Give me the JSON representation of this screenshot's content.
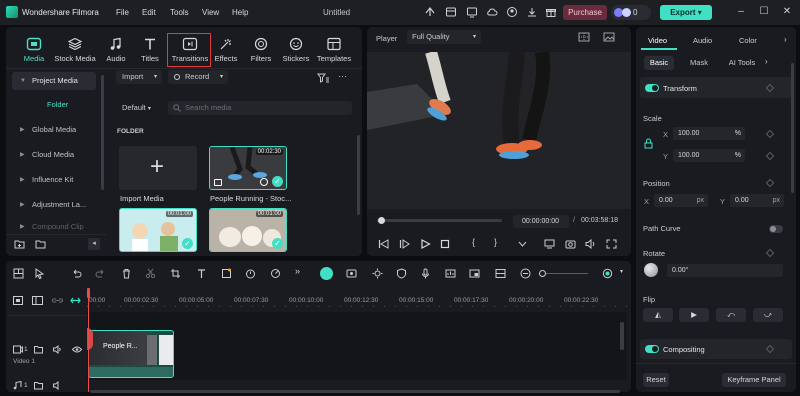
{
  "titlebar": {
    "app_name": "Wondershare Filmora",
    "menu": [
      "File",
      "Edit",
      "Tools",
      "View",
      "Help"
    ],
    "doc_title": "Untitled",
    "purchase_label": "Purchase",
    "credits": "0",
    "export_label": "Export"
  },
  "media_tabs": [
    {
      "label": "Media",
      "icon": "media-icon",
      "active": true
    },
    {
      "label": "Stock Media",
      "icon": "stock-media-icon",
      "active": false
    },
    {
      "label": "Audio",
      "icon": "audio-icon",
      "active": false
    },
    {
      "label": "Titles",
      "icon": "titles-icon",
      "active": false
    },
    {
      "label": "Transitions",
      "icon": "transitions-icon",
      "active": false
    },
    {
      "label": "Effects",
      "icon": "effects-icon",
      "active": false
    },
    {
      "label": "Filters",
      "icon": "filters-icon",
      "active": false
    },
    {
      "label": "Stickers",
      "icon": "stickers-icon",
      "active": false
    },
    {
      "label": "Templates",
      "icon": "templates-icon",
      "active": false
    }
  ],
  "media_sidebar": {
    "items": [
      {
        "label": "Project Media",
        "expanded": true
      },
      {
        "label": "Folder",
        "sub": true
      },
      {
        "label": "Global Media"
      },
      {
        "label": "Cloud Media"
      },
      {
        "label": "Influence Kit"
      },
      {
        "label": "Adjustment La..."
      },
      {
        "label": "Compound Clip"
      }
    ]
  },
  "media_toolbar": {
    "import_label": "Import",
    "record_label": "Record",
    "default_label": "Default",
    "search_placeholder": "Search media",
    "folder_heading": "FOLDER"
  },
  "media_items": [
    {
      "label": "Import Media",
      "duration": ""
    },
    {
      "label": "People Running - Stoc...",
      "duration": "00:02:30"
    },
    {
      "label": "",
      "duration": "00:01:00"
    },
    {
      "label": "",
      "duration": "00:01:00"
    }
  ],
  "player": {
    "label": "Player",
    "quality": "Full Quality",
    "current_time": "00:00:00:00",
    "total_time": "00:03:58:18",
    "separator": "/"
  },
  "props": {
    "tabs": [
      "Video",
      "Audio",
      "Color"
    ],
    "active_tab": "Video",
    "subtabs": [
      "Basic",
      "Mask",
      "AI Tools"
    ],
    "active_subtab": "Basic",
    "transform_label": "Transform",
    "scale_label": "Scale",
    "scale_x": "100.00",
    "scale_y": "100.00",
    "scale_unit": "%",
    "position_label": "Position",
    "pos_x": "0.00",
    "pos_y": "0.00",
    "pos_unit": "px",
    "x_label": "X",
    "y_label": "Y",
    "path_curve_label": "Path Curve",
    "rotate_label": "Rotate",
    "rotate_value": "0.00°",
    "flip_label": "Flip",
    "compositing_label": "Compositing",
    "reset_label": "Reset",
    "keyframe_label": "Keyframe Panel"
  },
  "timeline": {
    "ruler": [
      "00:00",
      "00:00:02:30",
      "00:00:05:00",
      "00:00:07:30",
      "00:00:10:00",
      "00:00:12:30",
      "00:00:15:00",
      "00:00:17:30",
      "00:00:20:00",
      "00:00:22:30"
    ],
    "track_name": "Video 1",
    "track_number": "1",
    "audio_track_number": "1",
    "clip_label": "People R..."
  },
  "colors": {
    "accent": "#3fe0c4",
    "highlight_box": "#e03a3a",
    "playhead": "#e84c4c"
  }
}
